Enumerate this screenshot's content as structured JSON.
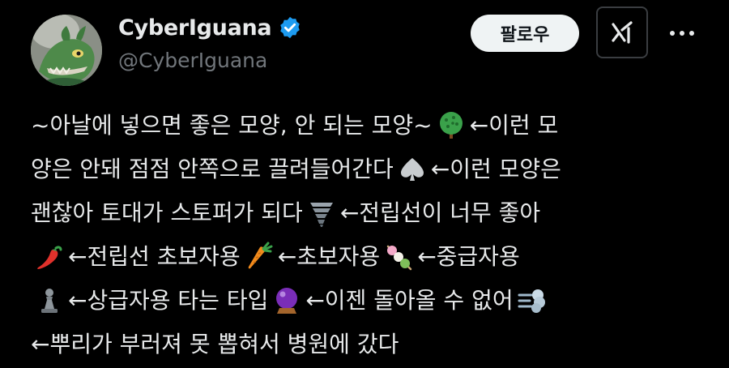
{
  "author": {
    "display_name": "CyberIguana",
    "handle": "@CyberIguana",
    "verified_icon": "verified-badge-icon",
    "avatar_icon": "iguana-avatar"
  },
  "actions": {
    "follow_label": "팔로우",
    "grok_icon": "grok-icon",
    "more_icon": "more-dots-icon"
  },
  "colors": {
    "background": "#000000",
    "text": "#e7e9ea",
    "secondary_text": "#71767b",
    "verified_blue": "#1d9bf0",
    "follow_bg": "#eff3f4"
  },
  "tweet": {
    "line1": {
      "a": "~아날에 넣으면 좋은 모양, 안 되는 모양~",
      "emoji1": "tree-icon",
      "b": "←이런 모"
    },
    "line2": {
      "a": "양은 안돼 점점 안쪽으로 끌려들어간다",
      "emoji1": "spade-icon",
      "b": "←이런 모양은"
    },
    "line3": {
      "a": "괜찮아 토대가 스토퍼가 되다",
      "emoji1": "tornado-icon",
      "b": "←전립선이 너무 좋아"
    },
    "line4": {
      "emoji1": "chili-pepper-icon",
      "a": "←전립선 초보자용",
      "emoji2": "carrot-icon",
      "b": "←초보자용",
      "emoji3": "dango-icon",
      "c": "←중급자용"
    },
    "line5": {
      "emoji1": "chess-pawn-icon",
      "a": "←상급자용 타는 타입",
      "emoji2": "crystal-ball-icon",
      "b": "←이젠 돌아올 수 없어",
      "emoji3": "dash-icon"
    },
    "line6": {
      "a": "←뿌리가 부러져 못 뽑혀서 병원에 갔다"
    }
  }
}
